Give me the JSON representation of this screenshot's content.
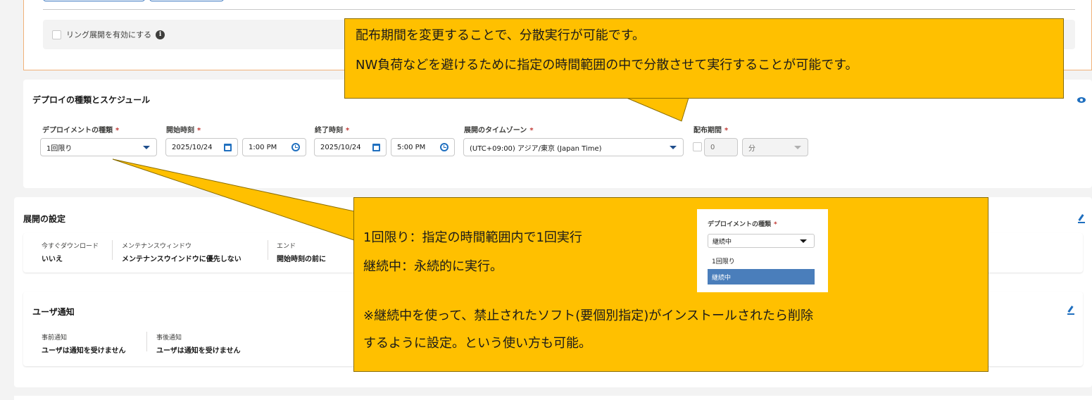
{
  "ring": {
    "label": "リング展開を有効にする"
  },
  "deploy": {
    "title": "デプロイの種類とスケジュール",
    "type_label": "デプロイメントの種類",
    "type_value": "1回限り",
    "start_label": "開始時刻",
    "start_date": "2025/10/24",
    "start_time": "1:00 PM",
    "end_label": "終了時刻",
    "end_date": "2025/10/24",
    "end_time": "5:00 PM",
    "tz_label": "展開のタイムゾーン",
    "tz_value": "(UTC+09:00) アジア/東京 (Japan Time)",
    "period_label": "配布期間",
    "period_value": "0",
    "period_unit": "分",
    "required_mark": "*"
  },
  "settings": {
    "title": "展開の設定",
    "items": [
      {
        "label": "今すぐダウンロード",
        "value": "いいえ"
      },
      {
        "label": "メンテナンスウィンドウ",
        "value": "メンテナンスウインドウに優先しない"
      },
      {
        "label": "エンド",
        "value": "開始時刻の前に"
      }
    ]
  },
  "notify": {
    "title": "ユーザ通知",
    "items": [
      {
        "label": "事前通知",
        "value": "ユーザは通知を受けません"
      },
      {
        "label": "事後通知",
        "value": "ユーザは通知を受けません"
      }
    ]
  },
  "callout_top": {
    "line1": "配布期間を変更することで、分散実行が可能です。",
    "line2": "NW負荷などを避けるために指定の時間範囲の中で分散させて実行することが可能です。"
  },
  "callout_bottom": {
    "line1": "1回限り：指定の時間範囲内で1回実行",
    "line2": "継続中：永続的に実行。",
    "line3": "※継続中を使って、禁止されたソフト(要個別指定)がインストールされたら削除",
    "line4": "するように設定。という使い方も可能。"
  },
  "mini_dropdown": {
    "label": "デプロイメントの種類",
    "current": "継続中",
    "options": [
      "1回限り",
      "継続中"
    ],
    "selected_color": "#4a7ebb"
  },
  "colors": {
    "accent": "#1f6fbf",
    "callout": "#ffc000",
    "required": "#c23934"
  }
}
